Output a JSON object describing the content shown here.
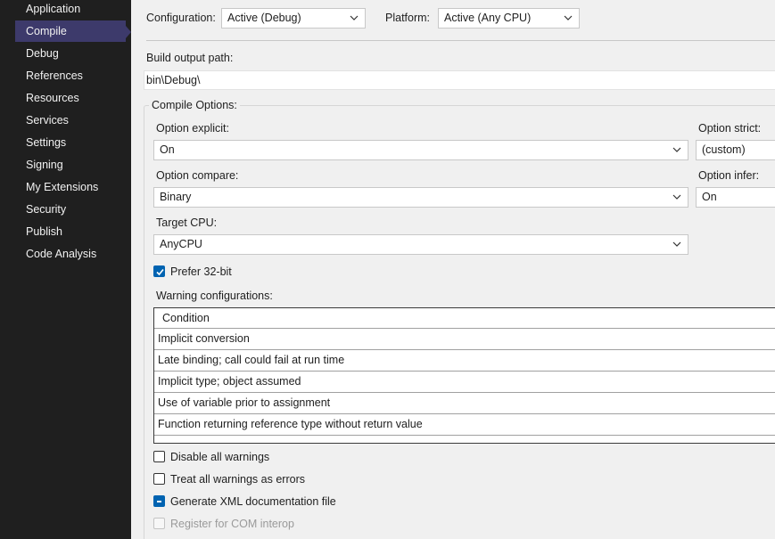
{
  "sidebar": {
    "items": [
      {
        "label": "Application"
      },
      {
        "label": "Compile"
      },
      {
        "label": "Debug"
      },
      {
        "label": "References"
      },
      {
        "label": "Resources"
      },
      {
        "label": "Services"
      },
      {
        "label": "Settings"
      },
      {
        "label": "Signing"
      },
      {
        "label": "My Extensions"
      },
      {
        "label": "Security"
      },
      {
        "label": "Publish"
      },
      {
        "label": "Code Analysis"
      }
    ],
    "active": "Compile"
  },
  "header": {
    "configuration_label": "Configuration:",
    "configuration_value": "Active (Debug)",
    "platform_label": "Platform:",
    "platform_value": "Active (Any CPU)"
  },
  "build": {
    "output_path_label": "Build output path:",
    "output_path_value": "bin\\Debug\\"
  },
  "compile_options": {
    "title": "Compile Options:",
    "option_explicit_label": "Option explicit:",
    "option_explicit_value": "On",
    "option_strict_label": "Option strict:",
    "option_strict_value": "(custom)",
    "option_compare_label": "Option compare:",
    "option_compare_value": "Binary",
    "option_infer_label": "Option infer:",
    "option_infer_value": "On",
    "target_cpu_label": "Target CPU:",
    "target_cpu_value": "AnyCPU",
    "prefer32_label": "Prefer 32-bit",
    "warning_config_label": "Warning configurations:"
  },
  "warnings_grid": {
    "header": "Condition",
    "rows": [
      "Implicit conversion",
      "Late binding; call could fail at run time",
      "Implicit type; object assumed",
      "Use of variable prior to assignment",
      "Function returning reference type without return value"
    ]
  },
  "checkboxes": {
    "disable_all_warnings": "Disable all warnings",
    "treat_warnings_as_errors": "Treat all warnings as errors",
    "generate_xml_doc": "Generate XML documentation file",
    "register_com_interop": "Register for COM interop"
  },
  "colors": {
    "sidebar_bg": "#1f1f1f",
    "sidebar_active": "#3d3a6b",
    "check_accent": "#0063b1"
  }
}
